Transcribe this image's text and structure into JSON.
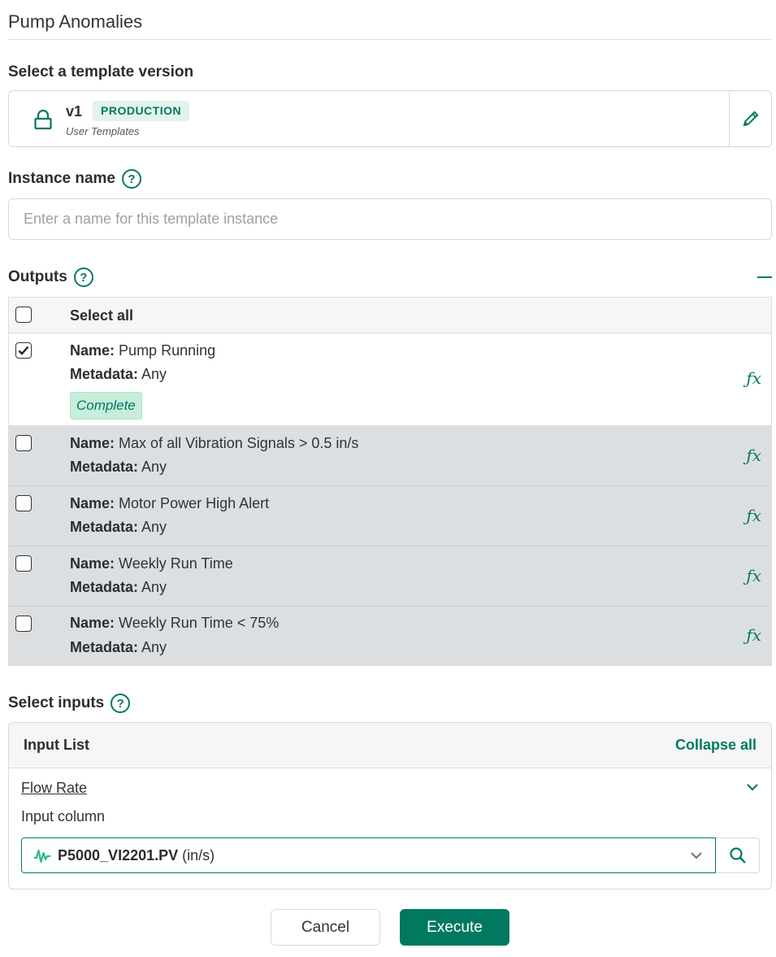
{
  "page": {
    "title": "Pump Anomalies"
  },
  "template_version": {
    "label": "Select a template version",
    "version": "v1",
    "badge": "PRODUCTION",
    "source": "User Templates",
    "icon": "lock-icon",
    "edit_icon": "pencil-icon"
  },
  "instance_name": {
    "label": "Instance name",
    "help_icon": "?",
    "placeholder": "Enter a name for this template instance",
    "value": ""
  },
  "outputs": {
    "label": "Outputs",
    "help_icon": "?",
    "select_all_label": "Select all",
    "name_key": "Name:",
    "metadata_key": "Metadata:",
    "fx_label": "ƒx",
    "rows": [
      {
        "name": "Pump Running",
        "metadata": "Any",
        "checked": true,
        "status": "Complete"
      },
      {
        "name": "Max of all Vibration Signals > 0.5 in/s",
        "metadata": "Any",
        "checked": false
      },
      {
        "name": "Motor Power High Alert",
        "metadata": "Any",
        "checked": false
      },
      {
        "name": "Weekly Run Time",
        "metadata": "Any",
        "checked": false
      },
      {
        "name": "Weekly Run Time < 75%",
        "metadata": "Any",
        "checked": false
      }
    ]
  },
  "inputs": {
    "label": "Select inputs",
    "help_icon": "?",
    "list_title": "Input List",
    "collapse_all": "Collapse all",
    "item_name": "Flow Rate",
    "column_label": "Input column",
    "signal_name": "P5000_VI2201.PV",
    "signal_unit": "(in/s)"
  },
  "actions": {
    "cancel": "Cancel",
    "execute": "Execute"
  },
  "colors": {
    "accent": "#007960",
    "badge_bg": "#e3f2ed",
    "complete_bg": "#c6eedb",
    "row_unselected_bg": "#dcdfe2"
  }
}
